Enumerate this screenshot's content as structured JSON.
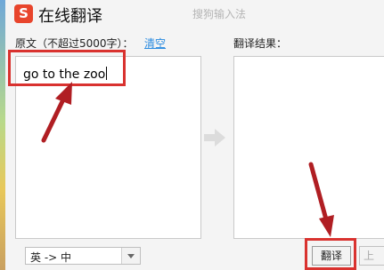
{
  "titlebar": {
    "logo_text": "S",
    "title": "在线翻译",
    "brand": "搜狗输入法"
  },
  "source": {
    "label": "原文（不超过5000字）：",
    "clear_label": "清空",
    "text": "go to the zoo"
  },
  "result": {
    "label": "翻译结果：",
    "text": ""
  },
  "controls": {
    "language_pair": "英 -> 中",
    "translate_label": "翻译",
    "next_label": "上"
  },
  "colors": {
    "logo": "#e8452c",
    "link": "#2a8be0",
    "highlight": "#d9322f",
    "annotation_arrow": "#b01e23"
  }
}
